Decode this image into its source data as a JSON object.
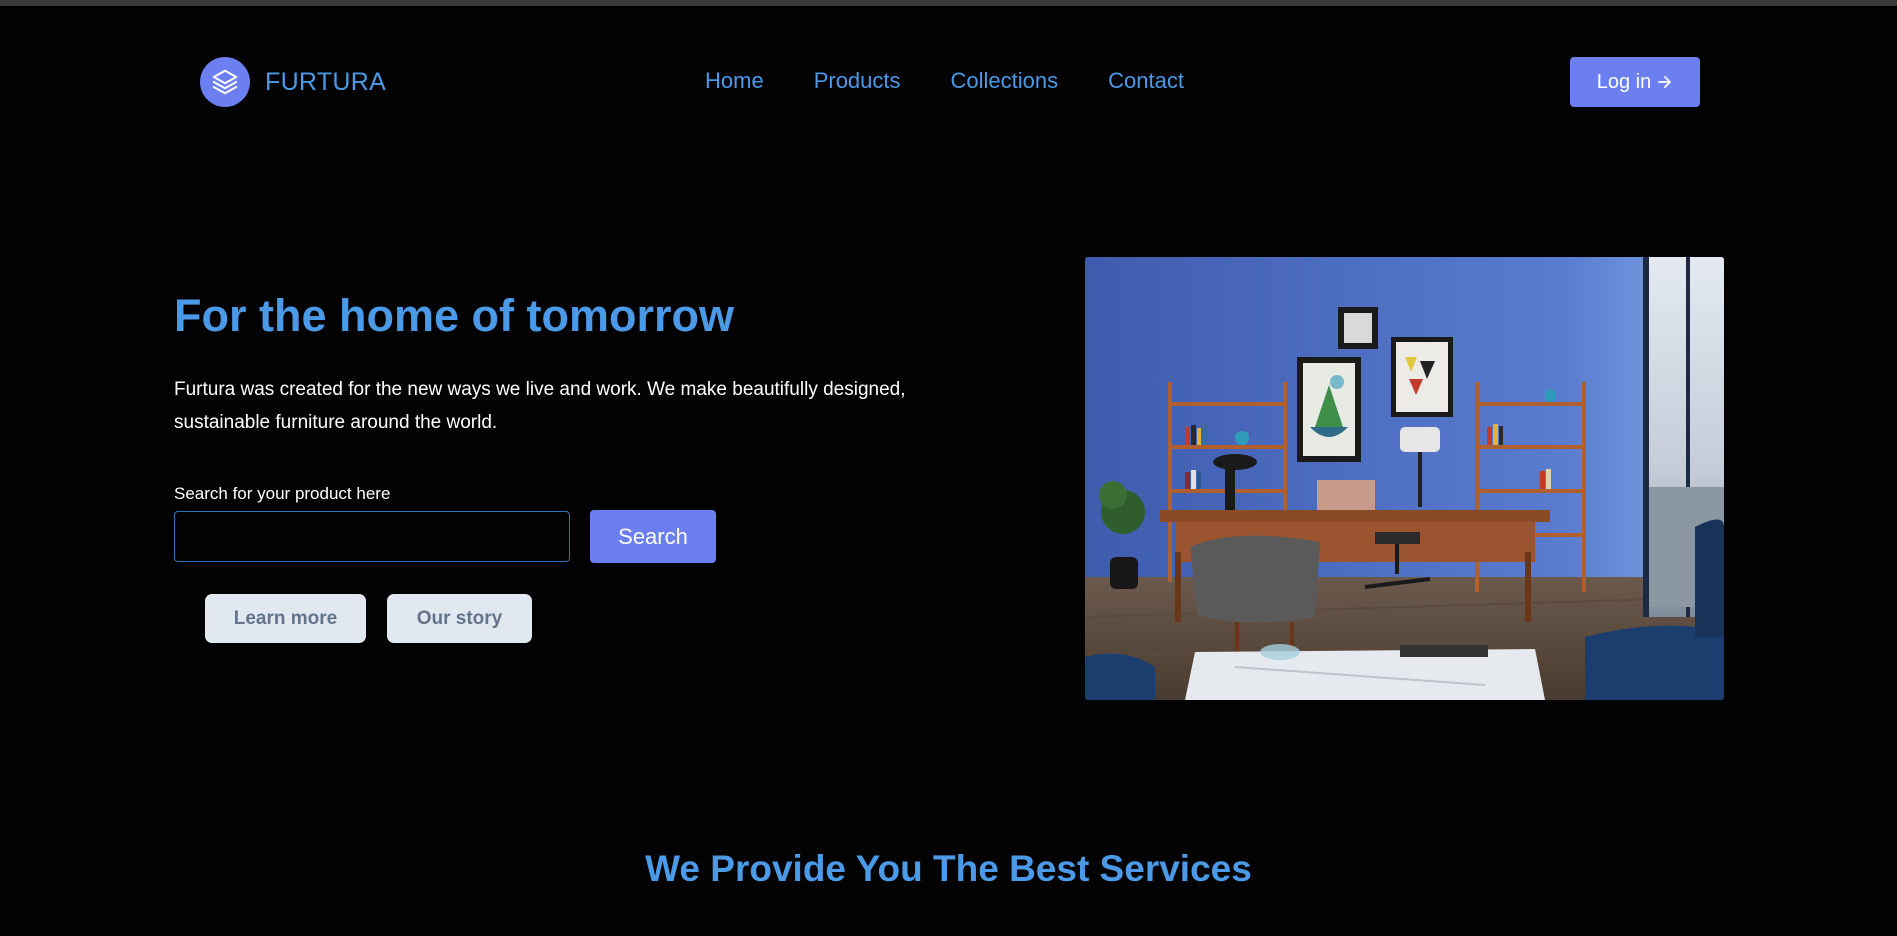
{
  "brand": {
    "name": "FURTURA",
    "icon": "layers-icon",
    "color": "#6b7ff0"
  },
  "nav": {
    "items": [
      {
        "label": "Home"
      },
      {
        "label": "Products"
      },
      {
        "label": "Collections"
      },
      {
        "label": "Contact"
      }
    ],
    "login_label": "Log in",
    "login_icon": "arrow-right-icon"
  },
  "hero": {
    "title": "For the home of tomorrow",
    "description": "Furtura was created for the new ways we live and work. We make beautifully designed, sustainable furniture around the world.",
    "search_label": "Search for your product here",
    "search_value": "",
    "search_button": "Search",
    "learn_more": "Learn more",
    "our_story": "Our story",
    "image_subject": "home office interior with desk, chairs, shelves and framed art"
  },
  "services": {
    "title": "We Provide You The Best Services"
  },
  "colors": {
    "accent": "#4a9ae8",
    "button": "#6b7ff0",
    "background": "#020202",
    "pill": "#e2e8f0"
  }
}
